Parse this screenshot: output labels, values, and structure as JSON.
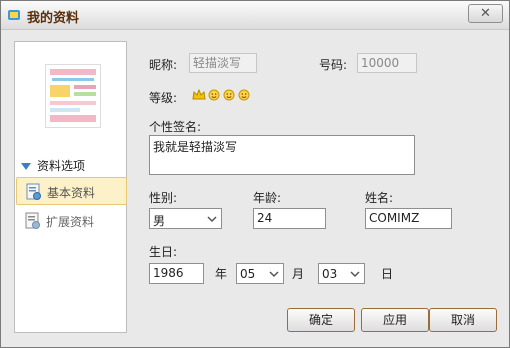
{
  "window": {
    "title": "我的资料",
    "close_label": "✕"
  },
  "sidebar": {
    "thumb_text": "",
    "header": "资料选项",
    "items": [
      {
        "label": "基本资料",
        "active": true
      },
      {
        "label": "扩展资料",
        "active": false
      }
    ]
  },
  "form": {
    "nickname_label": "昵称:",
    "nickname_value": "轻描淡写",
    "number_label": "号码:",
    "number_value": "10000",
    "level_label": "等级:",
    "signature_label": "个性签名:",
    "signature_value": "我就是轻描淡写",
    "gender_label": "性别:",
    "gender_value": "男",
    "age_label": "年龄:",
    "age_value": "24",
    "name_label": "姓名:",
    "name_value": "COMIMZ",
    "birthday_label": "生日:",
    "year_value": "1986",
    "year_unit": "年",
    "month_value": "05",
    "month_unit": "月",
    "day_value": "03",
    "day_unit": "日"
  },
  "buttons": {
    "ok": "确定",
    "apply": "应用",
    "cancel": "取消"
  },
  "colors": {
    "title_text": "#5a2e0c",
    "sidebar_active_bg": "#fdf1c9",
    "accent_blue": "#3a7fc4"
  }
}
